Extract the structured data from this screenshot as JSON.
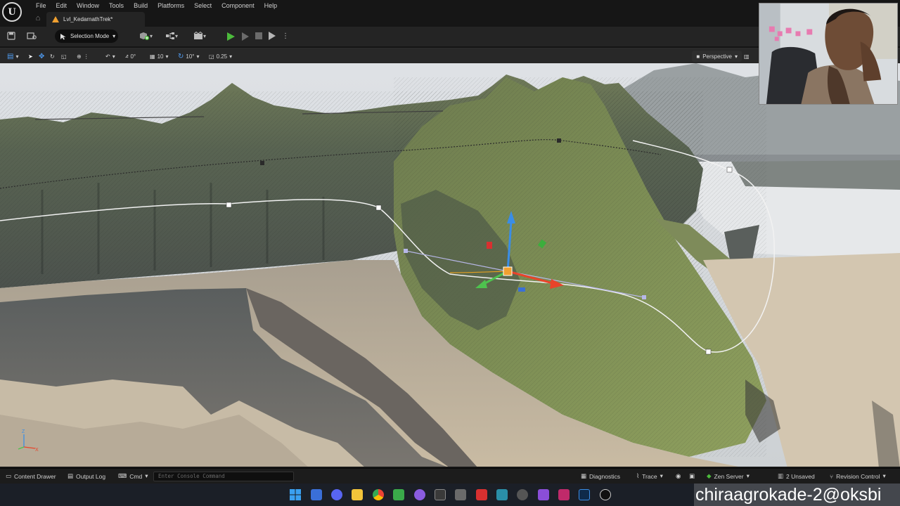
{
  "app": {
    "menus": [
      "File",
      "Edit",
      "Window",
      "Tools",
      "Build",
      "Platforms",
      "Select",
      "Component",
      "Help"
    ],
    "level_tab": "Lvl_KedarnathTrek*"
  },
  "toolbar": {
    "selection_mode": "Selection Mode"
  },
  "viewport_toolbar": {
    "rotate_snap_value": "0°",
    "grid_value": "10",
    "angle_value": "10°",
    "scale_value": "0.25",
    "view_mode": "Perspective"
  },
  "statusbar": {
    "content_drawer": "Content Drawer",
    "output_log": "Output Log",
    "cmd": "Cmd",
    "console_placeholder": "Enter Console Command",
    "diagnostics": "Diagnostics",
    "trace": "Trace",
    "zen_server": "Zen Server",
    "unsaved": "2 Unsaved",
    "revision_control": "Revision Control"
  },
  "overlay": {
    "watermark": "chiraagrokade-2@oksbi"
  },
  "colors": {
    "play_green": "#4cbb3c",
    "gizmo_x": "#e8442a",
    "gizmo_y": "#4ec24e",
    "gizmo_z": "#3a8de6",
    "level_icon": "#f0a030"
  }
}
